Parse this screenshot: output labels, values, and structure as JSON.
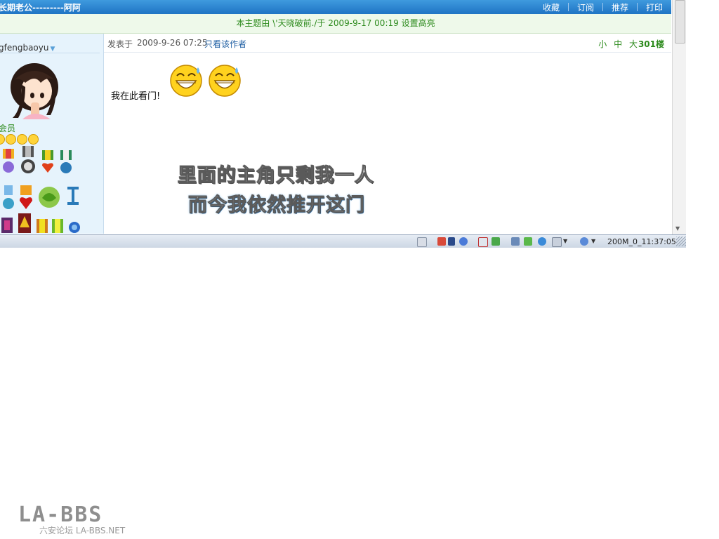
{
  "thread": {
    "title": "长期老公---------阿阿",
    "actions": [
      "收藏",
      "订阅",
      "推荐",
      "打印"
    ]
  },
  "highlight_notice": "本主题由 \\'天晓破前./于 2009-9-17 00:19 设置高亮",
  "user": {
    "username": "gfengbaoyu",
    "level": "会员",
    "avatar": "avatar-girl"
  },
  "post": {
    "posted_label": "发表于",
    "posted_time": "2009-9-26 07:25",
    "only_author_link": "只看该作者",
    "font_sizes": [
      "小",
      "中",
      "大"
    ],
    "floor": "301楼",
    "text": "我在此看门!",
    "emoticons": [
      "laughing-sweat-emoji",
      "laughing-sweat-emoji"
    ],
    "lyric_lines": [
      "里面的主角只剩我一人",
      "而今我依然推开这门"
    ]
  },
  "statusbar": {
    "clock": "200M_0_11:37:05"
  },
  "watermark": {
    "logo": "LA-BBS",
    "sub": "六安论坛 LA-BBS.NET"
  },
  "colors": {
    "title_bar": "#2a83d4",
    "highlight_bg": "#eef9ea",
    "green_text": "#2c8a1c",
    "sidebar_bg": "#e6f3fc",
    "link": "#1f5fa3"
  }
}
